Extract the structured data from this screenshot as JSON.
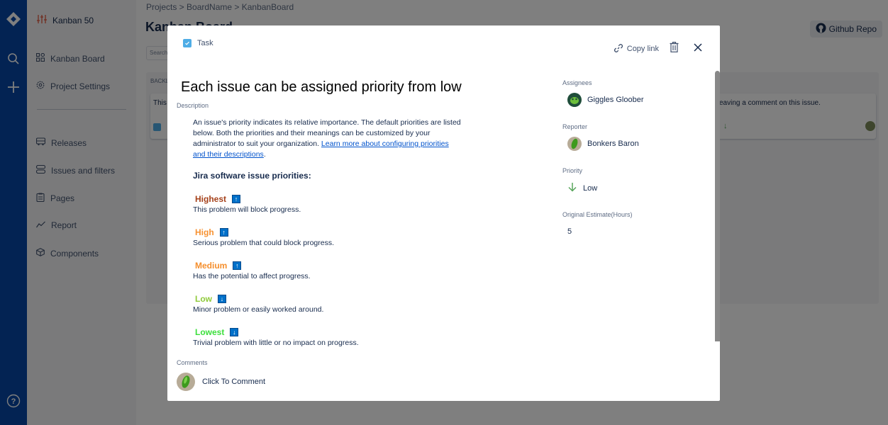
{
  "navbar": {
    "icons": [
      "jira-logo-icon",
      "search-icon",
      "plus-icon",
      "help-icon"
    ]
  },
  "sidebar": {
    "project_name": "Kanban 50",
    "items": [
      {
        "label": "Kanban Board",
        "icon": "board-icon"
      },
      {
        "label": "Project Settings",
        "icon": "gear-icon"
      },
      {
        "label": "Releases",
        "icon": "truck-icon"
      },
      {
        "label": "Issues and filters",
        "icon": "stack-icon"
      },
      {
        "label": "Pages",
        "icon": "clipboard-icon"
      },
      {
        "label": "Report",
        "icon": "chart-line-icon"
      },
      {
        "label": "Components",
        "icon": "cube-icon"
      }
    ]
  },
  "main": {
    "breadcrumb": "Projects > BoardName > KanbanBoard",
    "title": "Kanban Board",
    "github_label": "Github Repo",
    "search_placeholder": "Search",
    "column_title": "BACKLOG",
    "card_text_start": "This",
    "card_text_end": "eaving a comment on this issue."
  },
  "modal": {
    "issue_type": "Task",
    "copy_link_label": "Copy link",
    "title": "Each issue can be assigned priority from low",
    "description_label": "Description",
    "description_text": "An issue's priority indicates its relative importance. The default priorities are listed below. Both the priorities and their meanings can be customized by your administrator to suit your organization. ",
    "description_link": "Learn more about configuring priorities and their descriptions",
    "description_link_suffix": ".",
    "priorities_heading": "Jira software issue priorities:",
    "priorities": [
      {
        "name": "Highest",
        "color": "#a5411a",
        "direction": "up",
        "description": "This problem will block progress."
      },
      {
        "name": "High",
        "color": "#f79232",
        "direction": "up",
        "description": "Serious problem that could block progress."
      },
      {
        "name": "Medium",
        "color": "#f58f2d",
        "direction": "up",
        "description": "Has the potential to affect progress."
      },
      {
        "name": "Low",
        "color": "#8fca3a",
        "direction": "down",
        "description": "Minor problem or easily worked around."
      },
      {
        "name": "Lowest",
        "color": "#3cdf3c",
        "direction": "down",
        "description": "Trivial problem with little or no impact on progress."
      }
    ],
    "comments_label": "Comments",
    "comment_placeholder": "Click To Comment",
    "fields": {
      "assignees_label": "Assignees",
      "assignee": "Giggles Gloober",
      "reporter_label": "Reporter",
      "reporter": "Bonkers Baron",
      "priority_label": "Priority",
      "priority": "Low",
      "estimate_label": "Original Estimate(Hours)",
      "estimate": "5"
    }
  },
  "colors": {
    "navbar": "#0747a6",
    "link": "#0052cc",
    "task_icon": "#4fade6",
    "priority_low_arrow": "#57a55a"
  }
}
